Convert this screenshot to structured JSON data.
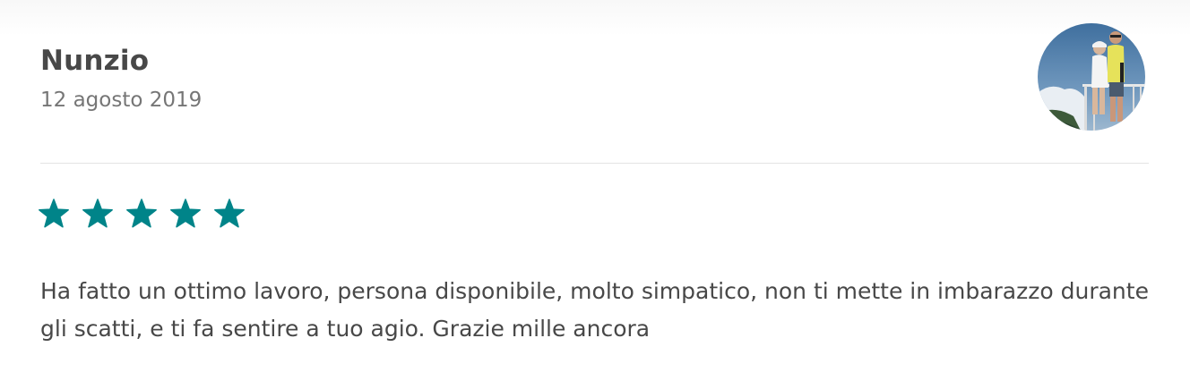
{
  "review": {
    "reviewer_name": "Nunzio",
    "date": "12 agosto 2019",
    "rating": 5,
    "rating_max": 5,
    "text": "Ha fatto un ottimo lavoro, persona disponibile, molto simpatico, non ti mette in imbarazzo durante gli scatti, e ti fa sentire a tuo agio. Grazie mille ancora"
  },
  "avatar": {
    "icon": "avatar-photo"
  },
  "colors": {
    "star": "#008489",
    "name": "#484848",
    "date": "#767676",
    "divider": "#e4e4e4"
  }
}
